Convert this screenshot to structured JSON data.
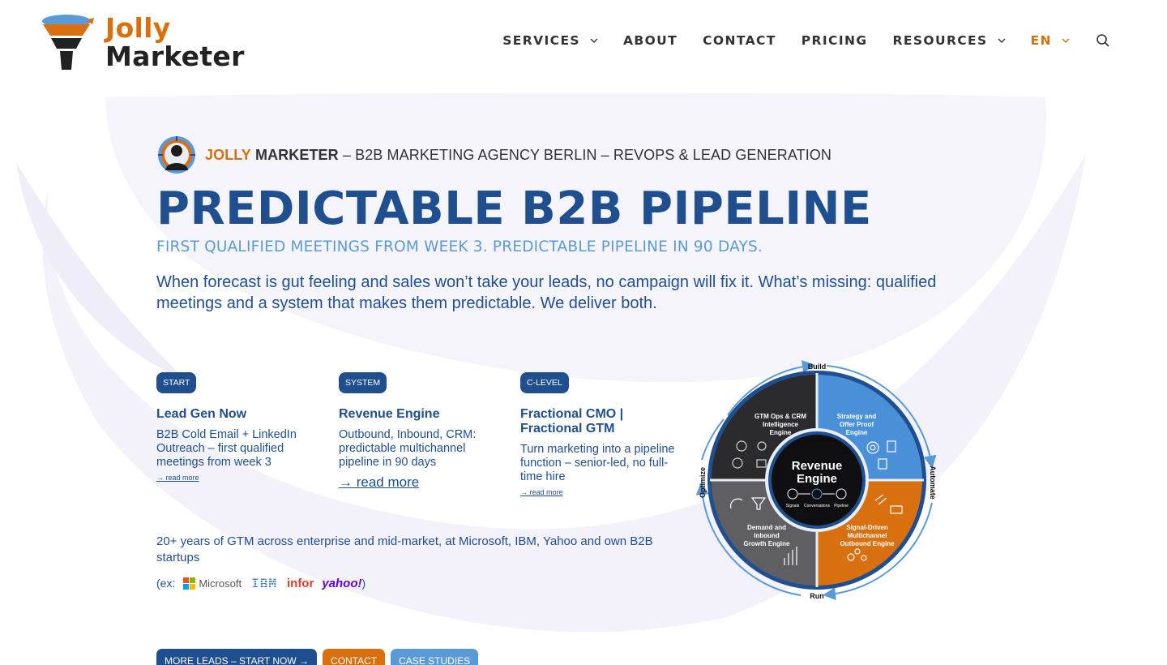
{
  "brand": {
    "logo_line1": "Jolly",
    "logo_line2": "Marketer",
    "colors": {
      "navy": "#1f4f8f",
      "orange": "#d9700f",
      "light_blue": "#5a9ad6",
      "dark": "#333333"
    }
  },
  "nav": {
    "items": [
      {
        "label": "SERVICES",
        "dropdown": true
      },
      {
        "label": "ABOUT",
        "dropdown": false
      },
      {
        "label": "CONTACT",
        "dropdown": false
      },
      {
        "label": "PRICING",
        "dropdown": false
      },
      {
        "label": "RESOURCES",
        "dropdown": true
      }
    ],
    "language": "EN",
    "search_icon": "search-icon"
  },
  "hero": {
    "kicker_jolly": "JOLLY",
    "kicker_marketer": "MARKETER",
    "kicker_rest": " – B2B MARKETING AGENCY BERLIN – REVOPS & LEAD GENERATION",
    "headline": "PREDICTABLE B2B PIPELINE",
    "subline": "FIRST QUALIFIED MEETINGS FROM WEEK 3. PREDICTABLE PIPELINE IN 90 DAYS.",
    "intro": "When forecast is gut feeling and sales won’t take your leads, no campaign will fix it. What’s missing: qualified meetings and a system that makes them predictable. We deliver both."
  },
  "cards": [
    {
      "badge": "START",
      "title": "Lead Gen Now",
      "desc": "B2B Cold Email + LinkedIn Outreach – first qualified meetings from week 3",
      "more": "→ read more"
    },
    {
      "badge": "SYSTEM",
      "title": "Revenue Engine",
      "desc": "Outbound, Inbound, CRM: predictable multichannel pipeline in 90 days",
      "more": "→ read more"
    },
    {
      "badge": "C-LEVEL",
      "title": "Fractional CMO | Fractional GTM",
      "desc": "Turn marketing into a pipeline function – senior-led, no full-time hire",
      "more": "→ read more"
    }
  ],
  "experience": {
    "text": "20+ years of GTM across enterprise and mid-market, at Microsoft, IBM, Yahoo and own B2B startups",
    "prefix": "(ex:",
    "suffix": ")",
    "brands": [
      "Microsoft",
      "IBM",
      "infor",
      "yahoo!"
    ]
  },
  "diagram": {
    "center_title_1": "Revenue",
    "center_title_2": "Engine",
    "center_steps": [
      "Signals",
      "Conversations",
      "Pipeline"
    ],
    "cycle_labels": {
      "top": "Build",
      "right": "Automate",
      "bottom": "Run",
      "left": "Optimize"
    },
    "quadrants": {
      "top_left": [
        "GTM Ops & CRM",
        "Intelligence",
        "Engine"
      ],
      "top_right": [
        "Strategy and",
        "Offer Proof",
        "Engine"
      ],
      "bottom_left": [
        "Demand and",
        "Inbound",
        "Growth Engine"
      ],
      "bottom_right": [
        "Signal-Driven",
        "Multichannel",
        "Outbound Engine"
      ]
    }
  },
  "ctas": [
    {
      "label": "MORE LEADS – START NOW →",
      "style": "blue"
    },
    {
      "label": "CONTACT",
      "style": "orange"
    },
    {
      "label": "CASE STUDIES",
      "style": "light"
    }
  ]
}
